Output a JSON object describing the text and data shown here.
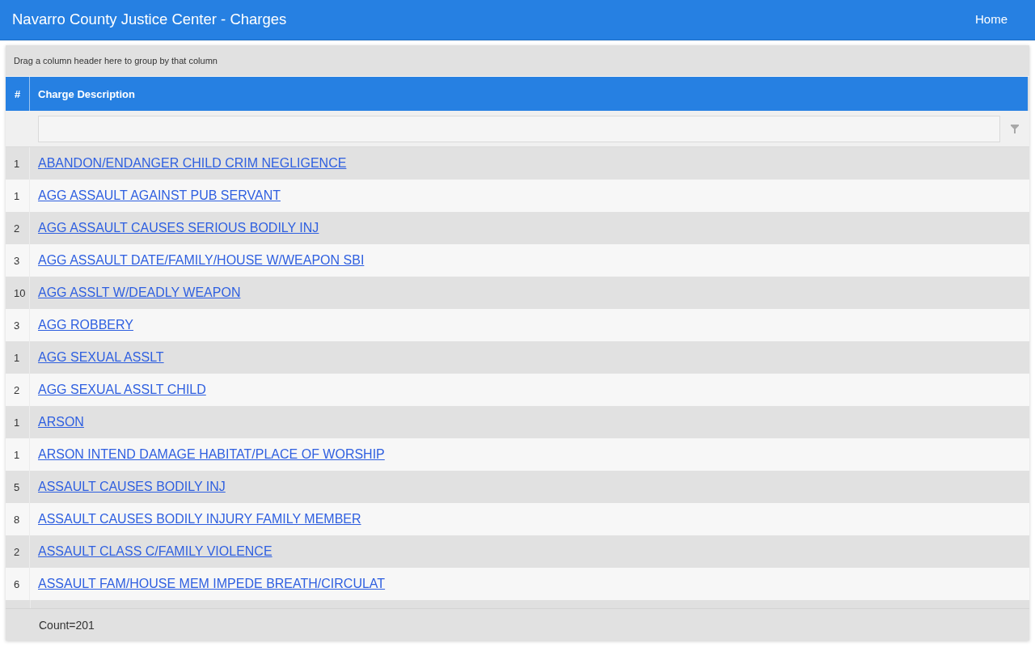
{
  "header": {
    "title": "Navarro County Justice Center - Charges",
    "nav": [
      {
        "label": "Home"
      }
    ]
  },
  "grid": {
    "group_panel": "Drag a column header here to group by that column",
    "columns": [
      "#",
      "Charge Description"
    ],
    "rows": [
      {
        "count": "1",
        "charge": "ABANDON/ENDANGER CHILD CRIM NEGLIGENCE"
      },
      {
        "count": "1",
        "charge": "AGG ASSAULT AGAINST PUB SERVANT"
      },
      {
        "count": "2",
        "charge": "AGG ASSAULT CAUSES SERIOUS BODILY INJ"
      },
      {
        "count": "3",
        "charge": "AGG ASSAULT DATE/FAMILY/HOUSE W/WEAPON SBI"
      },
      {
        "count": "10",
        "charge": "AGG ASSLT W/DEADLY WEAPON"
      },
      {
        "count": "3",
        "charge": "AGG ROBBERY"
      },
      {
        "count": "1",
        "charge": "AGG SEXUAL ASSLT"
      },
      {
        "count": "2",
        "charge": "AGG SEXUAL ASSLT CHILD"
      },
      {
        "count": "1",
        "charge": "ARSON"
      },
      {
        "count": "1",
        "charge": "ARSON INTEND DAMAGE HABITAT/PLACE OF WORSHIP"
      },
      {
        "count": "5",
        "charge": "ASSAULT CAUSES BODILY INJ"
      },
      {
        "count": "8",
        "charge": "ASSAULT CAUSES BODILY INJURY FAMILY MEMBER"
      },
      {
        "count": "2",
        "charge": "ASSAULT CLASS C/FAMILY VIOLENCE"
      },
      {
        "count": "6",
        "charge": "ASSAULT FAM/HOUSE MEM IMPEDE BREATH/CIRCULAT"
      }
    ],
    "footer": "Count=201"
  }
}
